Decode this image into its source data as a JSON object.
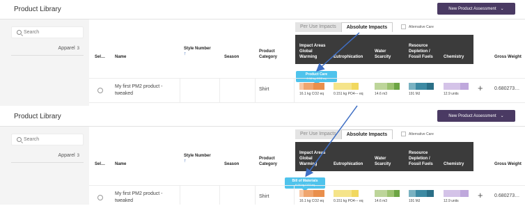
{
  "screens": [
    {
      "app_title": "Product Library",
      "new_button": "New Product Assessment",
      "search_placeholder": "Search",
      "filter": {
        "label": "Apparel",
        "count": "3"
      },
      "toggle": {
        "per_use": "Per Use Impacts",
        "absolute": "Absolute Impacts"
      },
      "alternative_care": "Alternative Care",
      "headers": {
        "select": "Sel…",
        "name": "Name",
        "style_number": "Style Number",
        "season": "Season",
        "product_category": "Product Category",
        "impact_areas": "Impact Areas Global Warming",
        "eutrophication": "Eutrophication",
        "water_scarcity": "Water Scarcity",
        "resource_depletion": "Resource Depletion / Fossil Fuels",
        "chemistry": "Chemistry",
        "gross_weight": "Gross Weight"
      },
      "row": {
        "name": "My first PM2 product - tweaked",
        "category": "Shirt",
        "global_warming": "16.1 kg CO2 eq",
        "eutrophication": "0.151 kg PO4--- eq",
        "water_scarcity": "14.6 m3",
        "resource_depletion": "191 MJ",
        "chemistry": "12.9 units",
        "gross_weight": "0.680273…"
      },
      "tooltip": {
        "title": "Product Care",
        "value": "0.18 kg CO2 eq"
      }
    },
    {
      "app_title": "Product Library",
      "new_button": "New Product Assessment",
      "search_placeholder": "Search",
      "filter": {
        "label": "Apparel",
        "count": "3"
      },
      "toggle": {
        "per_use": "Per Use Impacts",
        "absolute": "Absolute Impacts"
      },
      "alternative_care": "Alternative Care",
      "headers": {
        "select": "Sel…",
        "name": "Name",
        "style_number": "Style Number",
        "season": "Season",
        "product_category": "Product Category",
        "impact_areas": "Impact Areas Global Warming",
        "eutrophication": "Eutrophication",
        "water_scarcity": "Water Scarcity",
        "resource_depletion": "Resource Depletion / Fossil Fuels",
        "chemistry": "Chemistry",
        "gross_weight": "Gross Weight"
      },
      "row": {
        "name": "My first PM2 product - tweaked",
        "category": "Shirt",
        "global_warming": "16.1 kg CO2 eq",
        "eutrophication": "0.151 kg PO4--- eq",
        "water_scarcity": "14.6 m3",
        "resource_depletion": "191 MJ",
        "chemistry": "12.9 units",
        "gross_weight": "0.680273…"
      },
      "tooltip": {
        "title": "Bill of Materials",
        "value": "6.00 kg CO2 eq"
      }
    }
  ],
  "colors": {
    "brand_button": "#4a3a63",
    "tooltip": "#4fc3ec",
    "arrow": "#3f6fc4",
    "global_warming_bar": [
      "#f7c8a5",
      "#efa56e",
      "#e98f4c"
    ],
    "eutrophication_bar": [
      "#f5e48a",
      "#f1d85e"
    ],
    "water_bar": [
      "#bdd59a",
      "#9cc270",
      "#6da544"
    ],
    "resource_bar": [
      "#7ab2c2",
      "#3d8aa3",
      "#2a6f87"
    ],
    "chemistry_bar": [
      "#d4c3e8",
      "#bfa8dc"
    ]
  }
}
